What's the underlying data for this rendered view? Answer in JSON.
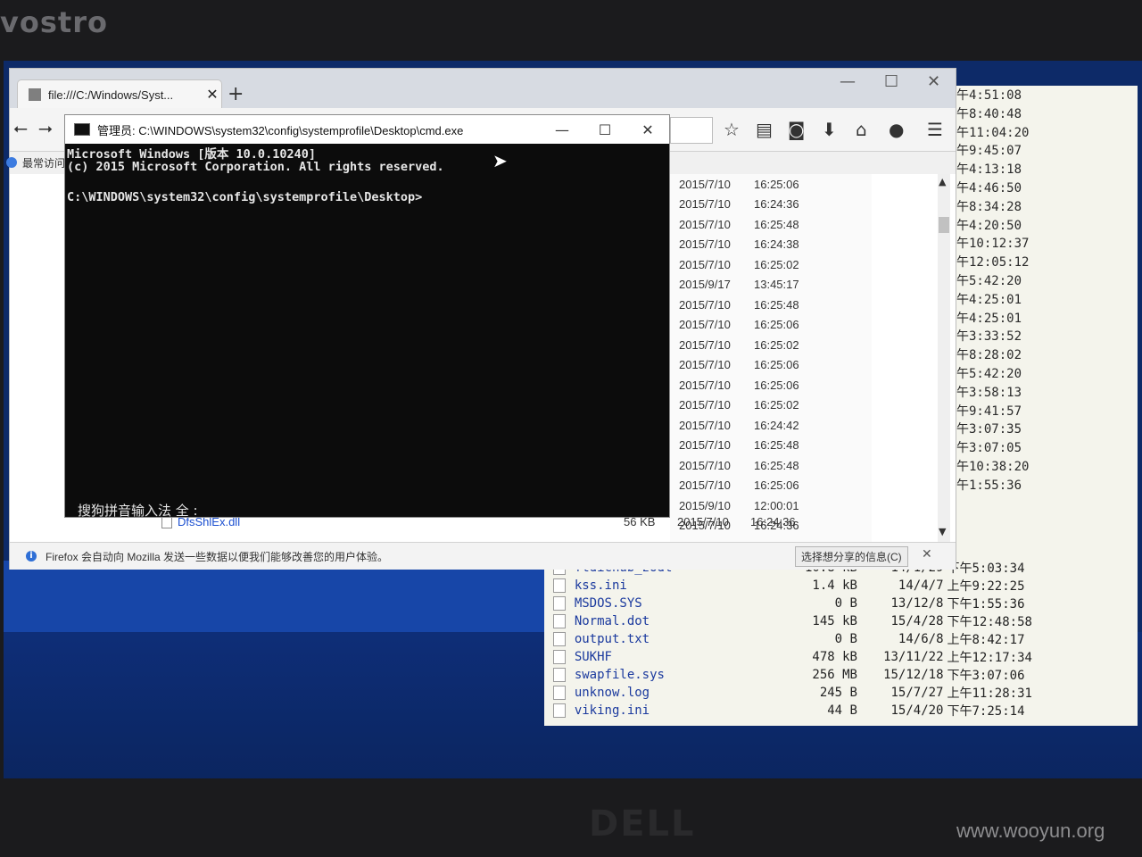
{
  "bezel": {
    "brand": "vostro",
    "bottom_logo": "DELL"
  },
  "watermark": "www.wooyun.org",
  "firefox": {
    "tab_title": "file:///C:/Windows/Syst...",
    "tab_close": "✕",
    "new_tab": "+",
    "bookmarks_label": "最常访问",
    "listing": [
      {
        "date": "2015/7/10",
        "time": "16:25:06"
      },
      {
        "date": "2015/7/10",
        "time": "16:24:36"
      },
      {
        "date": "2015/7/10",
        "time": "16:25:48"
      },
      {
        "date": "2015/7/10",
        "time": "16:24:38"
      },
      {
        "date": "2015/7/10",
        "time": "16:25:02"
      },
      {
        "date": "2015/9/17",
        "time": "13:45:17"
      },
      {
        "date": "2015/7/10",
        "time": "16:25:48"
      },
      {
        "date": "2015/7/10",
        "time": "16:25:06"
      },
      {
        "date": "2015/7/10",
        "time": "16:25:02"
      },
      {
        "date": "2015/7/10",
        "time": "16:25:06"
      },
      {
        "date": "2015/7/10",
        "time": "16:25:06"
      },
      {
        "date": "2015/7/10",
        "time": "16:25:02"
      },
      {
        "date": "2015/7/10",
        "time": "16:24:42"
      },
      {
        "date": "2015/7/10",
        "time": "16:25:48"
      },
      {
        "date": "2015/7/10",
        "time": "16:25:48"
      },
      {
        "date": "2015/7/10",
        "time": "16:25:06"
      },
      {
        "date": "2015/9/10",
        "time": "12:00:01"
      },
      {
        "date": "2015/7/10",
        "time": "16:24:36"
      }
    ],
    "dll_name": "DfsShlEx.dll",
    "dll_size": "56 KB",
    "dll_date": "2015/7/10",
    "dll_time": "16:24:36",
    "notice_text": "Firefox 会自动向 Mozilla 发送一些数据以便我们能够改善您的用户体验。",
    "notice_button": "选择想分享的信息(C)",
    "notice_close": "✕"
  },
  "cmd": {
    "title": "管理员: C:\\WINDOWS\\system32\\config\\systemprofile\\Desktop\\cmd.exe",
    "line1": "Microsoft Windows [版本 10.0.10240]",
    "line2": "(c) 2015 Microsoft Corporation. All rights reserved.",
    "line3": "C:\\WINDOWS\\system32\\config\\systemprofile\\Desktop>",
    "ime_status": "搜狗拼音输入法 全 :",
    "minimize": "—",
    "maximize": "☐",
    "close": "✕"
  },
  "back_window": {
    "times": [
      "下午4:51:08",
      "上午8:40:48",
      "上午11:04:20",
      "上午9:45:07",
      "下午4:13:18",
      "下午4:46:50",
      "上午8:34:28",
      "下午4:20:50",
      "上午10:12:37",
      "下午12:05:12",
      "上午5:42:20",
      "下午4:25:01",
      "下午4:25:01",
      "下午3:33:52",
      "上午8:28:02",
      "上午5:42:20",
      "下午3:58:13",
      "上午9:41:57",
      "下午3:07:35",
      "下午3:07:05",
      "上午10:38:20",
      "下午1:55:36"
    ],
    "files": [
      {
        "name": "ftdichub_zodt",
        "size": "10.8 kB",
        "date": "14/1/29",
        "time": "下午5:03:34"
      },
      {
        "name": "kss.ini",
        "size": "1.4 kB",
        "date": "14/4/7",
        "time": "上午9:22:25"
      },
      {
        "name": "MSDOS.SYS",
        "size": "0 B",
        "date": "13/12/8",
        "time": "下午1:55:36"
      },
      {
        "name": "Normal.dot",
        "size": "145 kB",
        "date": "15/4/28",
        "time": "下午12:48:58"
      },
      {
        "name": "output.txt",
        "size": "0 B",
        "date": "14/6/8",
        "time": "上午8:42:17"
      },
      {
        "name": "SUKHF",
        "size": "478 kB",
        "date": "13/11/22",
        "time": "上午12:17:34"
      },
      {
        "name": "swapfile.sys",
        "size": "256 MB",
        "date": "15/12/18",
        "time": "下午3:07:06"
      },
      {
        "name": "unknow.log",
        "size": "245 B",
        "date": "15/7/27",
        "time": "上午11:28:31"
      },
      {
        "name": "viking.ini",
        "size": "44 B",
        "date": "15/4/20",
        "time": "下午7:25:14"
      }
    ]
  }
}
